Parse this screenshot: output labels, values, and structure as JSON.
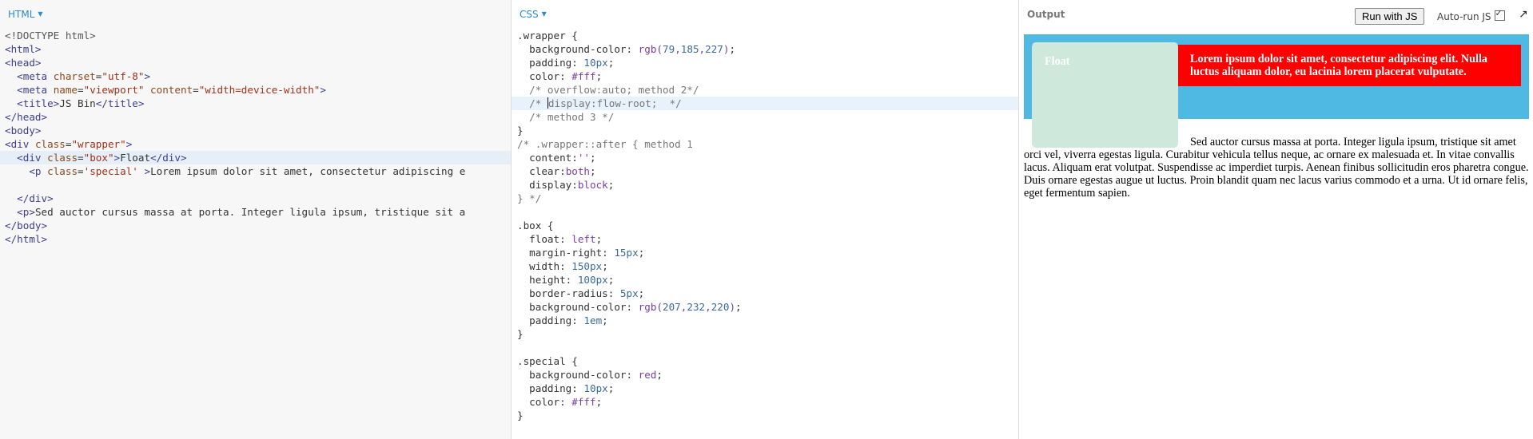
{
  "panels": {
    "html_label": "HTML",
    "css_label": "CSS",
    "output_label": "Output"
  },
  "output_controls": {
    "run_button": "Run with JS",
    "autorun_label": "Auto-run JS",
    "autorun_checked": true
  },
  "html_code": [
    "<!DOCTYPE html>",
    "<html>",
    "<head>",
    "  <meta charset=\"utf-8\">",
    "  <meta name=\"viewport\" content=\"width=device-width\">",
    "  <title>JS Bin</title>",
    "</head>",
    "<body>",
    "<div class=\"wrapper\">",
    "  <div class=\"box\">Float</div>",
    "    <p class='special' >Lorem ipsum dolor sit amet, consectetur adipiscing e",
    "",
    "  </div>",
    "  <p>Sed auctor cursus massa at porta. Integer ligula ipsum, tristique sit a",
    "</body>",
    "</html>"
  ],
  "css_code": [
    ".wrapper {",
    "  background-color: rgb(79,185,227);",
    "  padding: 10px;",
    "  color: #fff;",
    "  /* overflow:auto; method 2*/",
    "  /* display:flow-root;  */",
    "  /* method 3 */",
    "}",
    "/* .wrapper::after { method 1",
    "  content:'';",
    "  clear:both;",
    "  display:block;",
    "} */",
    "",
    ".box {",
    "  float: left;",
    "  margin-right: 15px;",
    "  width: 150px;",
    "  height: 100px;",
    "  border-radius: 5px;",
    "  background-color: rgb(207,232,220);",
    "  padding: 1em;",
    "}",
    "",
    ".special {",
    "  background-color: red;",
    "  padding: 10px;",
    "  color: #fff;",
    "}"
  ],
  "output": {
    "box_text": "Float",
    "special_text": "Lorem ipsum dolor sit amet, consectetur adipiscing elit. Nulla luctus aliquam dolor, eu lacinia lorem placerat vulputate.",
    "paragraph_text": "Sed auctor cursus massa at porta. Integer ligula ipsum, tristique sit amet orci vel, viverra egestas ligula. Curabitur vehicula tellus neque, ac ornare ex malesuada et. In vitae convallis lacus. Aliquam erat volutpat. Suspendisse ac imperdiet turpis. Aenean finibus sollicitudin eros pharetra congue. Duis ornare egestas augue ut luctus. Proin blandit quam nec lacus varius commodo et a urna. Ut id ornare felis, eget fermentum sapien."
  },
  "colors": {
    "wrapper_bg": "#4fb9e3",
    "box_bg": "#cfe8dc",
    "special_bg": "#ff0000",
    "tab_label": "#2a8bd0"
  }
}
